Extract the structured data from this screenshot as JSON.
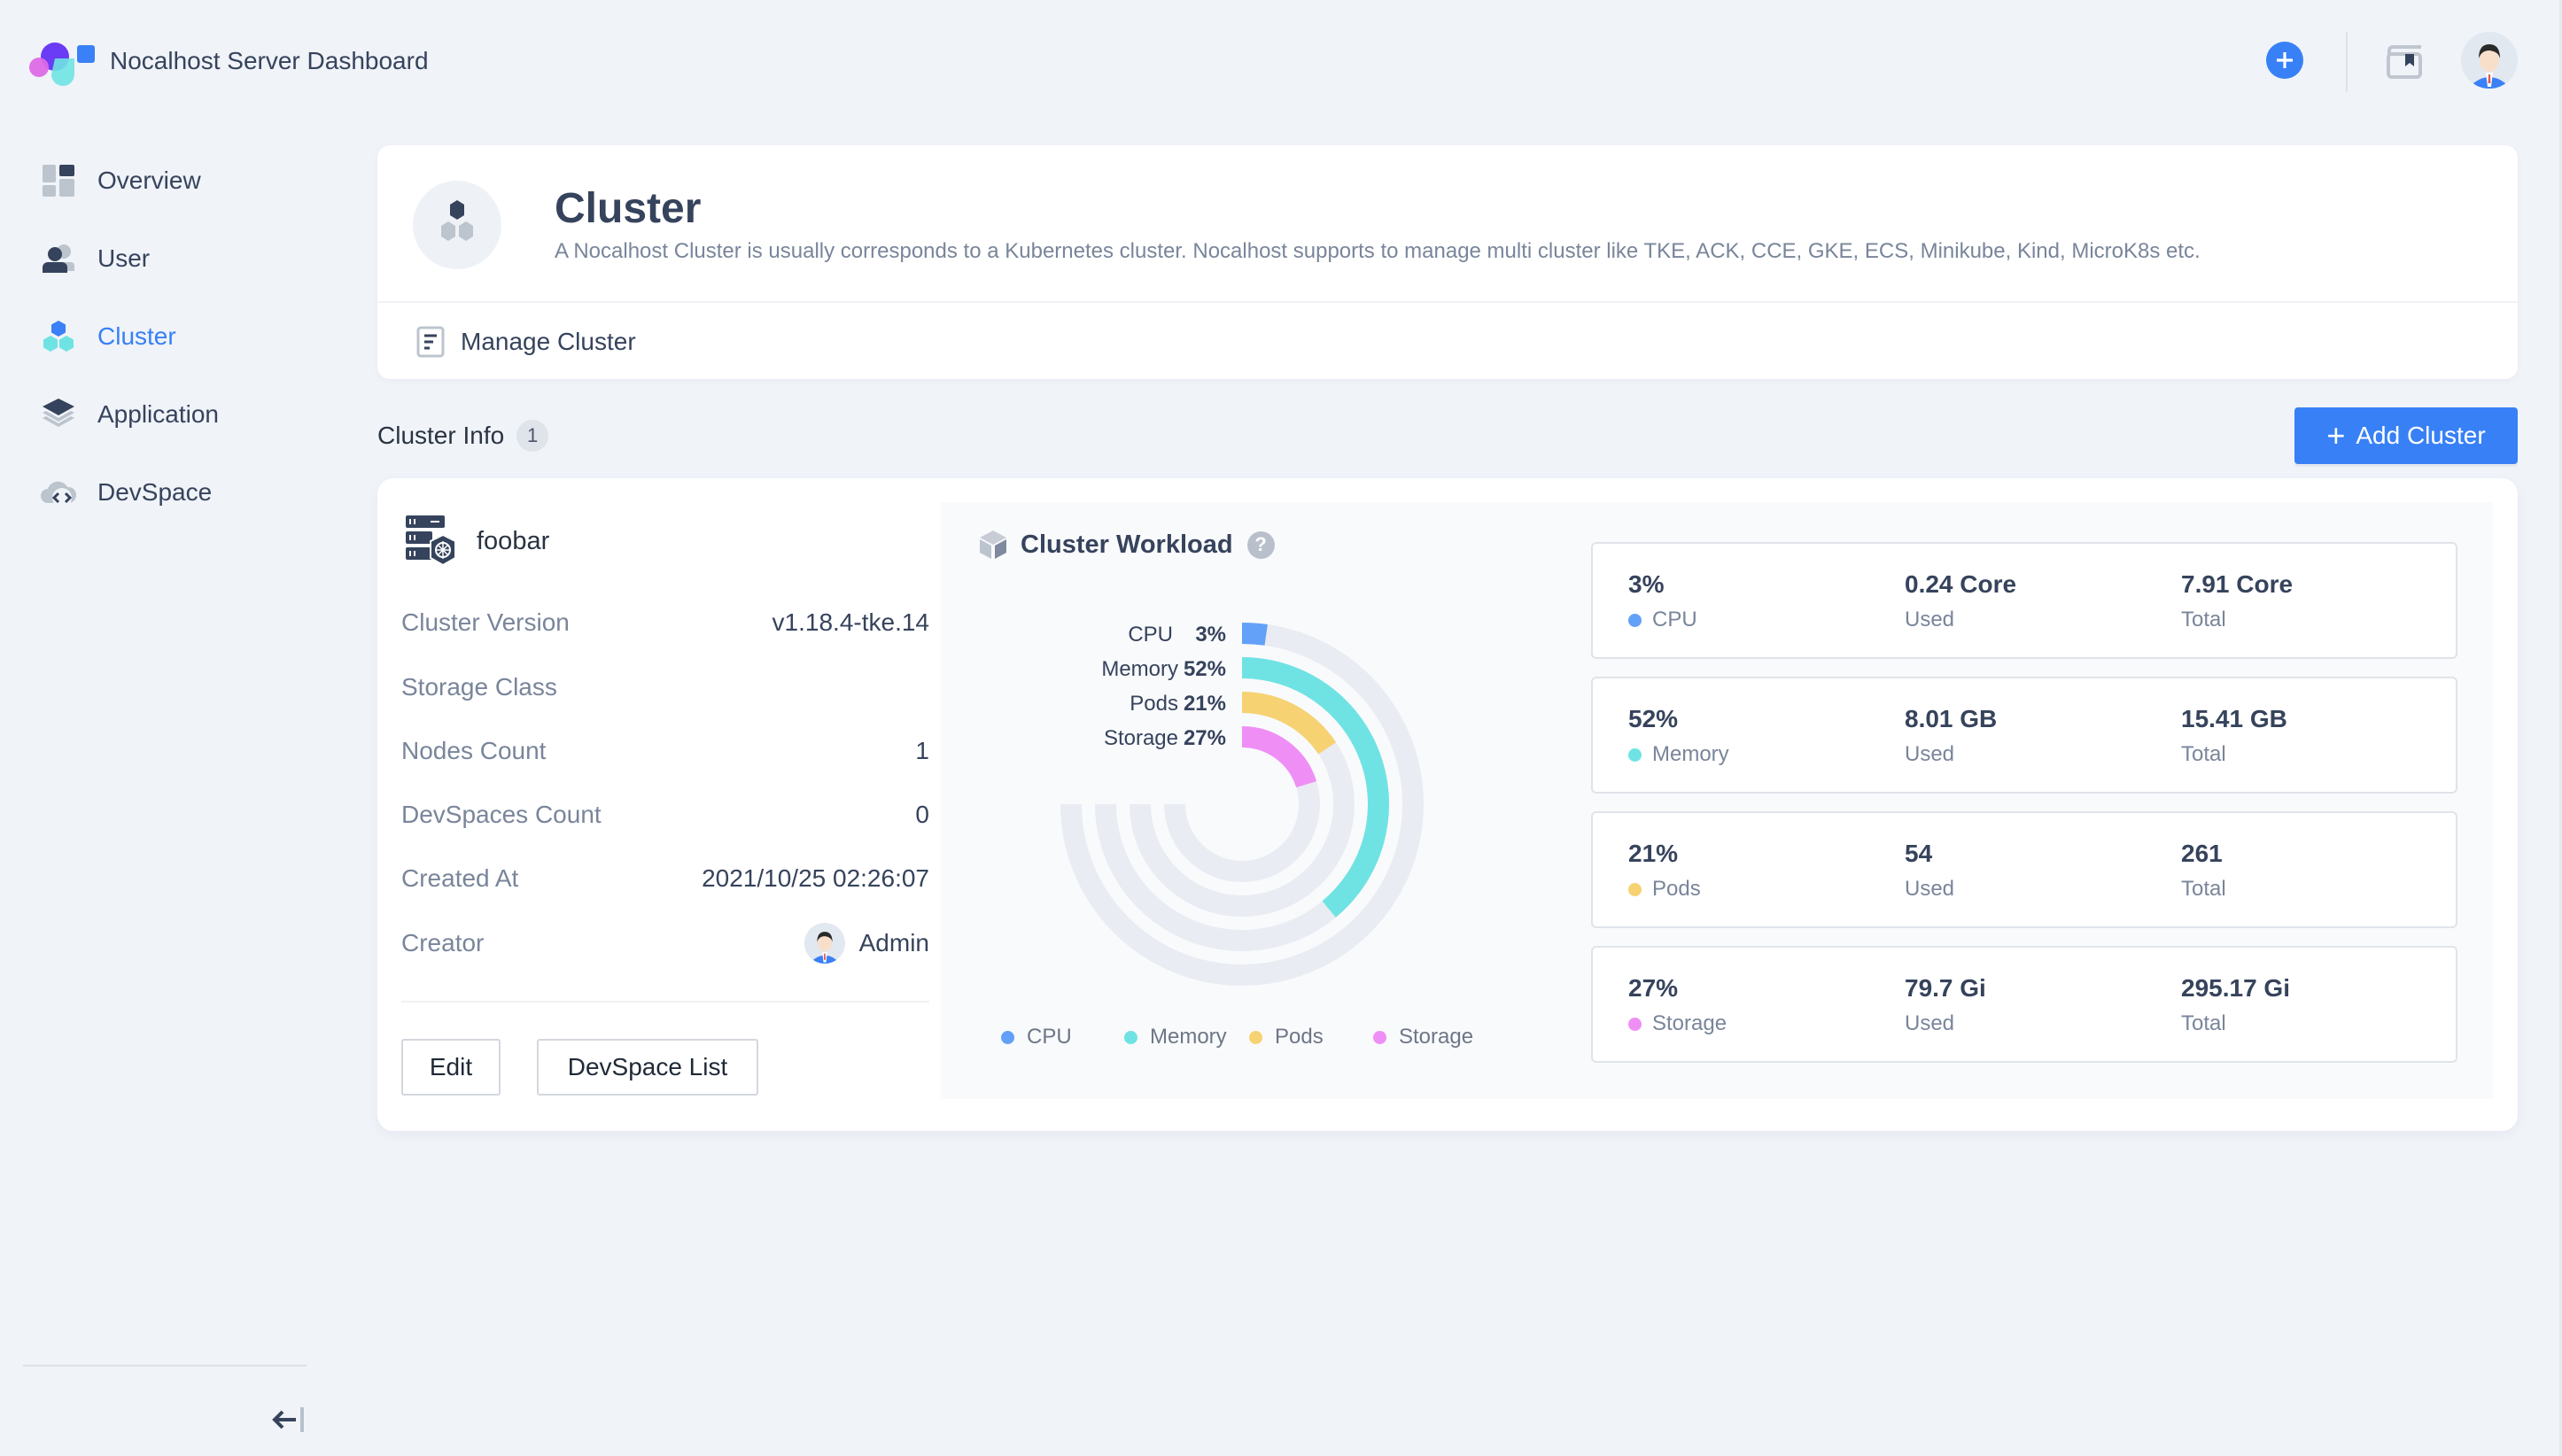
{
  "app": {
    "title": "Nocalhost Server Dashboard",
    "header_actions": {
      "add_icon": "plus-circle-icon",
      "docs_icon": "bookmark-docs-icon",
      "avatar": "user-avatar"
    }
  },
  "sidebar": {
    "items": [
      {
        "label": "Overview",
        "icon": "dashboard-icon",
        "active": false
      },
      {
        "label": "User",
        "icon": "users-icon",
        "active": false
      },
      {
        "label": "Cluster",
        "icon": "cluster-icon",
        "active": true
      },
      {
        "label": "Application",
        "icon": "layers-icon",
        "active": false
      },
      {
        "label": "DevSpace",
        "icon": "cloud-code-icon",
        "active": false
      }
    ],
    "collapse_label": "←|"
  },
  "page": {
    "title": "Cluster",
    "description": "A Nocalhost Cluster is usually corresponds to a Kubernetes cluster. Nocalhost supports to manage multi cluster like TKE, ACK, CCE, GKE, ECS, Minikube, Kind, MicroK8s etc.",
    "manage_label": "Manage Cluster"
  },
  "section": {
    "title": "Cluster Info",
    "count": "1",
    "add_button": "Add Cluster",
    "add_button_plus": "+"
  },
  "cluster": {
    "name": "foobar",
    "info": [
      {
        "key": "Cluster Version",
        "value": "v1.18.4-tke.14"
      },
      {
        "key": "Storage Class",
        "value": ""
      },
      {
        "key": "Nodes Count",
        "value": "1"
      },
      {
        "key": "DevSpaces Count",
        "value": "0"
      },
      {
        "key": "Created At",
        "value": "2021/10/25 02:26:07"
      },
      {
        "key": "Creator",
        "value": "Admin"
      }
    ],
    "buttons": {
      "edit": "Edit",
      "devspace_list": "DevSpace List"
    }
  },
  "workload": {
    "title": "Cluster Workload",
    "help": "?",
    "stats": [
      {
        "percent": "3%",
        "name": "CPU",
        "used": "0.24 Core",
        "used_label": "Used",
        "total": "7.91 Core",
        "total_label": "Total",
        "color": "#62a1f7"
      },
      {
        "percent": "52%",
        "name": "Memory",
        "used": "8.01 GB",
        "used_label": "Used",
        "total": "15.41 GB",
        "total_label": "Total",
        "color": "#6fe3e3"
      },
      {
        "percent": "21%",
        "name": "Pods",
        "used": "54",
        "used_label": "Used",
        "total": "261",
        "total_label": "Total",
        "color": "#f7d273"
      },
      {
        "percent": "27%",
        "name": "Storage",
        "used": "79.7 Gi",
        "used_label": "Used",
        "total": "295.17 Gi",
        "total_label": "Total",
        "color": "#ef8ff5"
      }
    ]
  },
  "chart_data": {
    "type": "radial-bar",
    "title": "Cluster Workload",
    "max_angle_degrees": 270,
    "track_color": "#e9ecf3",
    "series": [
      {
        "name": "CPU",
        "value": 3,
        "label": "3%",
        "color": "#62a1f7"
      },
      {
        "name": "Memory",
        "value": 52,
        "label": "52%",
        "color": "#6fe3e3"
      },
      {
        "name": "Pods",
        "value": 21,
        "label": "21%",
        "color": "#f7d273"
      },
      {
        "name": "Storage",
        "value": 27,
        "label": "27%",
        "color": "#ef8ff5"
      }
    ],
    "range": [
      0,
      100
    ],
    "legend": {
      "position": "bottom",
      "entries": [
        "CPU",
        "Memory",
        "Pods",
        "Storage"
      ]
    }
  }
}
